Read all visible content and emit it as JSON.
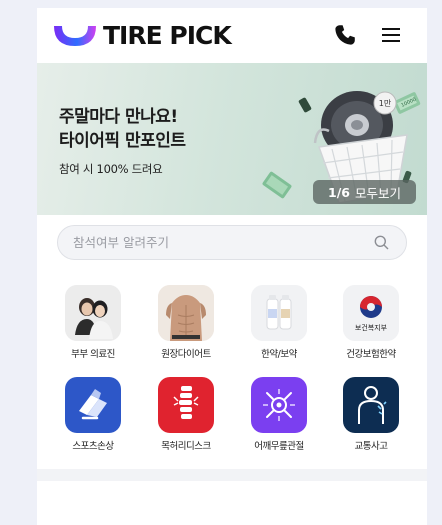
{
  "header": {
    "brand": "TIRE PICK",
    "colors": {
      "logo_gradient": [
        "#5b3df5",
        "#2f78ff",
        "#e040fb"
      ],
      "text": "#111111"
    }
  },
  "banner": {
    "title_line1": "주말마다 만나요!",
    "title_line2": "타이어픽 만포인트",
    "subtitle": "참여 시 100% 드려요",
    "pager_current": "1/6",
    "pager_label": "모두보기",
    "bg_color": "#d3e5dc",
    "badge_text": "1만",
    "bill_text": "10000"
  },
  "search": {
    "placeholder": "참석여부 알려주기",
    "icon": "search-icon"
  },
  "categories": [
    {
      "label": "부부 의료진",
      "icon": "couple-photo"
    },
    {
      "label": "원장다이어트",
      "icon": "torso-photo"
    },
    {
      "label": "한약/보약",
      "icon": "herbal-bottles"
    },
    {
      "label": "건강보험한약",
      "icon": "health-ministry-logo",
      "logo_text": "보건복지부"
    },
    {
      "label": "스포츠손상",
      "icon": "sports-injury-icon",
      "color": "#2d57c8"
    },
    {
      "label": "목허리디스크",
      "icon": "spine-icon",
      "color": "#e0232f"
    },
    {
      "label": "어깨무릎관절",
      "icon": "joint-icon",
      "color": "#7b3ff0"
    },
    {
      "label": "교통사고",
      "icon": "body-injury-icon",
      "color": "#0d2d52"
    }
  ]
}
